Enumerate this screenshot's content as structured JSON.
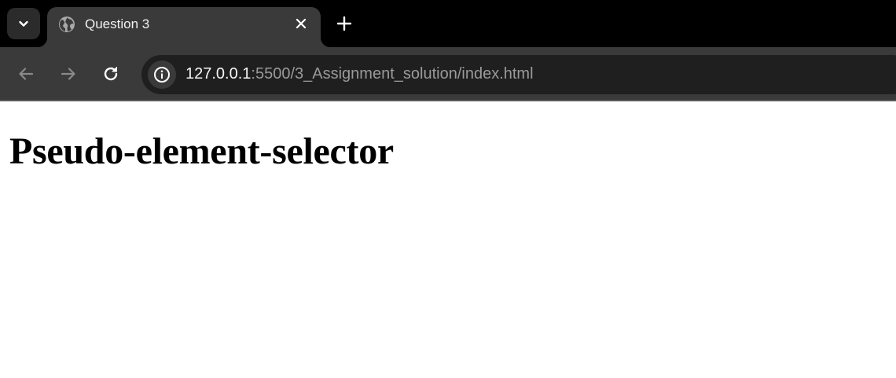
{
  "browser": {
    "tab": {
      "title": "Question 3",
      "favicon": "globe-icon"
    },
    "toolbar": {
      "url_host": "127.0.0.1",
      "url_rest": ":5500/3_Assignment_solution/index.html",
      "icons": {
        "back": "arrow-left-icon",
        "forward": "arrow-right-icon",
        "reload": "reload-icon",
        "site_info": "info-icon"
      }
    },
    "tab_strip": {
      "search_tabs_icon": "chevron-down-icon",
      "new_tab_icon": "plus-icon",
      "close_tab_icon": "close-icon"
    },
    "colors": {
      "tab_strip_bg": "#000000",
      "toolbar_bg": "#3a3a3a",
      "omnibox_bg": "#1f1f1f",
      "url_host": "#f5f5f5",
      "url_rest": "#9a9a9a"
    }
  },
  "page": {
    "heading": "Pseudo-element-selector"
  }
}
